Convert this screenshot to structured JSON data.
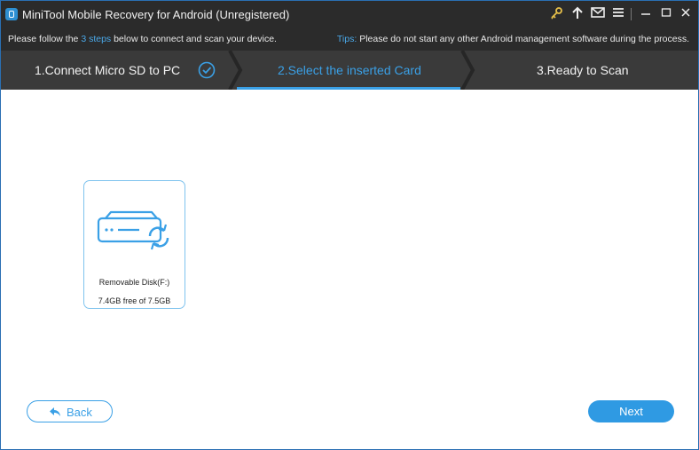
{
  "window": {
    "title": "MiniTool Mobile Recovery for Android (Unregistered)",
    "titlebar_icons": [
      "key-icon",
      "upload-icon",
      "mail-icon",
      "menu-icon"
    ],
    "controls": [
      "minimize-icon",
      "maximize-icon",
      "close-icon"
    ]
  },
  "info": {
    "left_prefix": "Please follow the ",
    "left_highlight": "3 steps",
    "left_suffix": " below to connect and scan your device.",
    "tips_label": "Tips:",
    "tips_text": " Please do not start any other Android management software during the process."
  },
  "steps": [
    {
      "label": "1.Connect Micro SD to PC",
      "state": "done"
    },
    {
      "label": "2.Select the inserted Card",
      "state": "active"
    },
    {
      "label": "3.Ready to Scan",
      "state": "pending"
    }
  ],
  "card": {
    "name": "Removable Disk(F:)",
    "size": "7.4GB free of 7.5GB",
    "icon": "removable-disk-icon"
  },
  "buttons": {
    "back": "Back",
    "next": "Next"
  },
  "colors": {
    "accent": "#3aa0e6",
    "titlebar": "#2b2b2b",
    "stepsbar": "#3a3a3a"
  }
}
